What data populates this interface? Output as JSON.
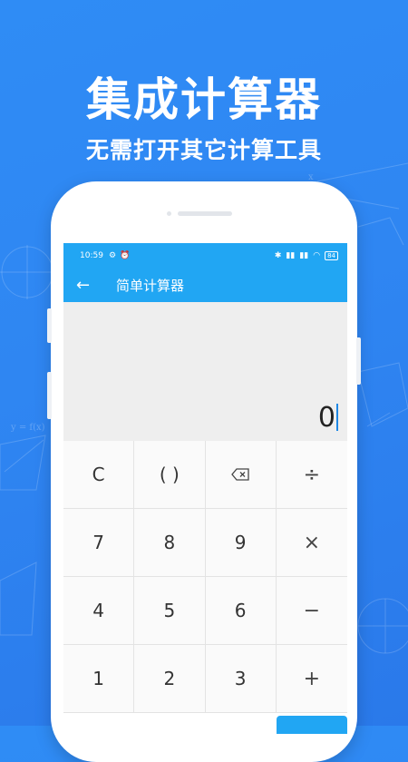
{
  "banner": {
    "title": "集成计算器",
    "subtitle": "无需打开其它计算工具"
  },
  "status_bar": {
    "time": "10:59",
    "battery": "84"
  },
  "app_bar": {
    "title": "简单计算器"
  },
  "display": {
    "value": "0"
  },
  "keypad": {
    "rows": [
      [
        "C",
        "( )",
        "⌫",
        "÷"
      ],
      [
        "7",
        "8",
        "9",
        "×"
      ],
      [
        "4",
        "5",
        "6",
        "−"
      ],
      [
        "1",
        "2",
        "3",
        "+"
      ]
    ]
  },
  "colors": {
    "background": "#2f86f2",
    "app_bar": "#21a6f3",
    "display_bg": "#eeeeee"
  }
}
